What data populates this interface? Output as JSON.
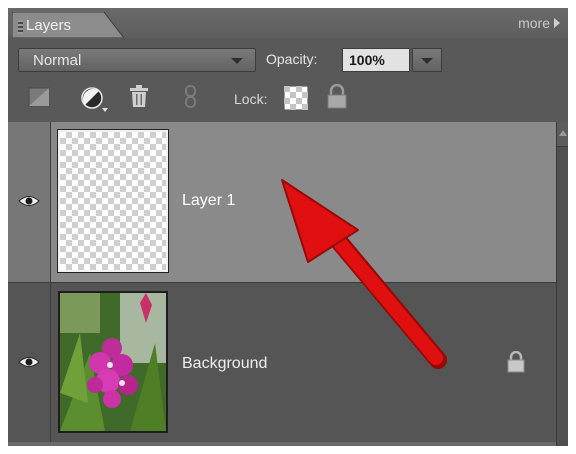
{
  "panel": {
    "tab_label": "Layers",
    "more_label": "more"
  },
  "controls": {
    "blend_mode": "Normal",
    "opacity_label": "Opacity:",
    "opacity_value": "100%",
    "lock_label": "Lock:"
  },
  "layers": [
    {
      "name": "Layer 1",
      "selected": true,
      "transparent": true,
      "locked": false
    },
    {
      "name": "Background",
      "selected": false,
      "transparent": false,
      "locked": true
    }
  ],
  "icons": [
    "new-layer-icon",
    "adjustment-layer-icon",
    "trash-icon",
    "link-icon",
    "lock-transparent-icon",
    "lock-all-icon",
    "eye-icon",
    "layer-lock-icon"
  ],
  "colors": {
    "panel_bg": "#595959",
    "selected_row": "#8a8a8a",
    "arrow": "#e01010"
  }
}
